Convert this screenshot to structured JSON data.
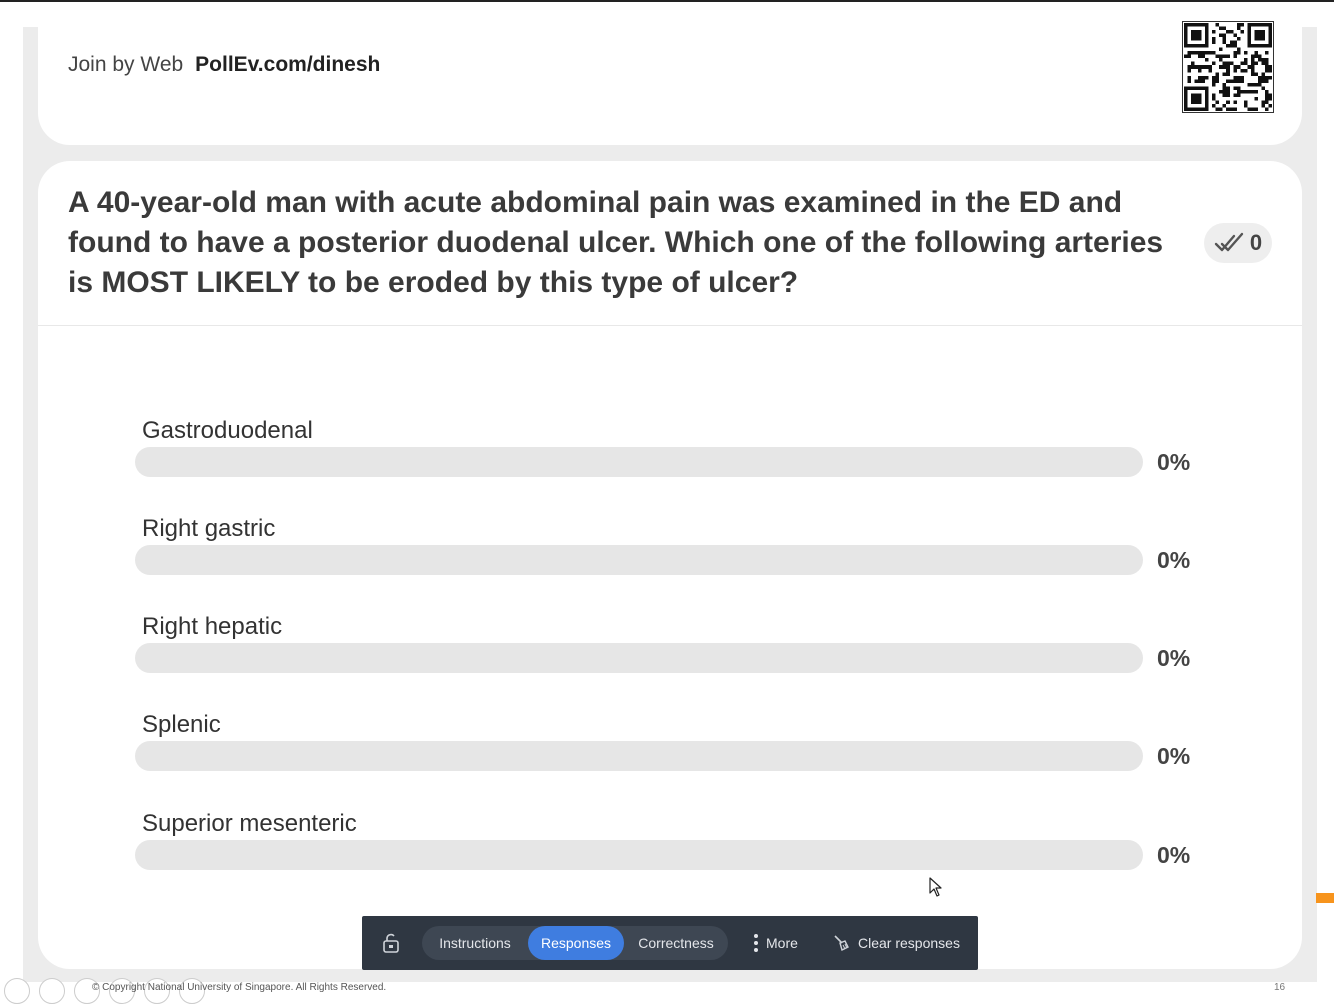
{
  "header": {
    "join_label": "Join by Web",
    "join_url": "PollEv.com/dinesh",
    "qr_icon": "qr-code-icon"
  },
  "question": {
    "text": "A 40-year-old man with acute abdominal pain was examined in the ED and found to have a posterior duodenal ulcer. Which one of the following arteries is MOST LIKELY to be eroded by this type of ulcer?",
    "response_count": "0",
    "response_icon": "checkmarks-icon"
  },
  "options": [
    {
      "label": "Gastroduodenal",
      "percent": "0%",
      "fraction": 0
    },
    {
      "label": "Right gastric",
      "percent": "0%",
      "fraction": 0
    },
    {
      "label": "Right hepatic",
      "percent": "0%",
      "fraction": 0
    },
    {
      "label": "Splenic",
      "percent": "0%",
      "fraction": 0
    },
    {
      "label": "Superior mesenteric",
      "percent": "0%",
      "fraction": 0
    }
  ],
  "toolbar": {
    "tabs": [
      "Instructions",
      "Responses",
      "Correctness"
    ],
    "active_tab": "Responses",
    "more_label": "More",
    "clear_label": "Clear responses",
    "accent_color": "#3f7de0"
  },
  "footer": {
    "copyright": "© Copyright National University of Singapore. All Rights Reserved.",
    "page_number": "16"
  }
}
